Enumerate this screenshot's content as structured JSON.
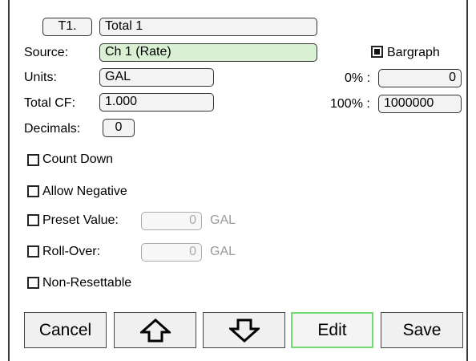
{
  "header": {
    "tag": "T1.",
    "name": "Total 1"
  },
  "fields": {
    "source_label": "Source:",
    "source_value": "Ch 1 (Rate)",
    "units_label": "Units:",
    "units_value": "GAL",
    "total_cf_label": "Total CF:",
    "total_cf_value": "1.000",
    "decimals_label": "Decimals:",
    "decimals_value": "0"
  },
  "bargraph": {
    "label": "Bargraph",
    "checked": true,
    "zero_label": "0% :",
    "zero_value": "0",
    "hundred_label": "100% :",
    "hundred_value": "1000000"
  },
  "options": {
    "count_down": "Count Down",
    "allow_negative": "Allow Negative",
    "preset_label": "Preset Value:",
    "preset_value": "0",
    "preset_unit": "GAL",
    "rollover_label": "Roll-Over:",
    "rollover_value": "0",
    "rollover_unit": "GAL",
    "non_resettable": "Non-Resettable"
  },
  "toolbar": {
    "cancel": "Cancel",
    "up_icon": "arrow-up-icon",
    "down_icon": "arrow-down-icon",
    "edit": "Edit",
    "save": "Save"
  },
  "colors": {
    "source_field_bg": "#d9f0d3",
    "edit_highlight": "#6fdc6f"
  }
}
